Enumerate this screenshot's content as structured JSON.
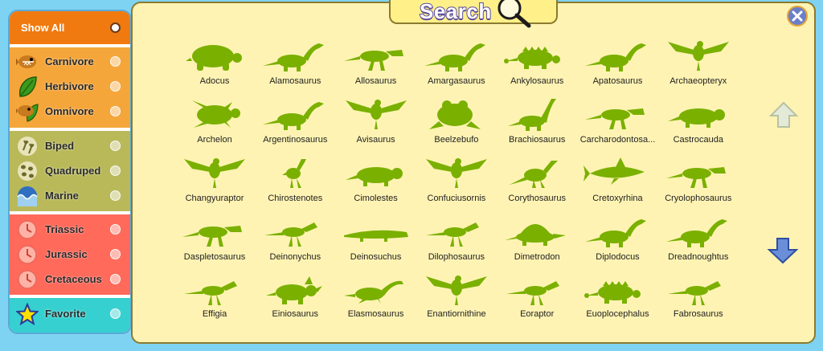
{
  "colors": {
    "background": "#7fd3f2",
    "panel": "#fff3b3",
    "silhouette": "#7ab000",
    "show_all": "#f07a10",
    "diet": "#f5a63a",
    "movement": "#b9b95a",
    "period": "#ff6a5a",
    "favorite": "#36d0d0"
  },
  "sidebar": {
    "show_all": {
      "label": "Show All",
      "selected": true
    },
    "diet": [
      {
        "label": "Carnivore",
        "icon": "carnivore-fish-icon"
      },
      {
        "label": "Herbivore",
        "icon": "leaf-icon"
      },
      {
        "label": "Omnivore",
        "icon": "omnivore-fish-leaf-icon"
      }
    ],
    "movement": [
      {
        "label": "Biped",
        "icon": "biped-footprints-icon"
      },
      {
        "label": "Quadruped",
        "icon": "quadruped-footprints-icon"
      },
      {
        "label": "Marine",
        "icon": "wave-icon"
      }
    ],
    "period": [
      {
        "label": "Triassic",
        "icon": "clock-icon"
      },
      {
        "label": "Jurassic",
        "icon": "clock-icon"
      },
      {
        "label": "Cretaceous",
        "icon": "clock-icon"
      }
    ],
    "favorite": {
      "label": "Favorite",
      "icon": "star-icon"
    }
  },
  "header": {
    "title": "Search",
    "icon": "magnifier-icon"
  },
  "controls": {
    "close_icon": "close-icon",
    "up_icon": "arrow-up-icon",
    "down_icon": "arrow-down-icon"
  },
  "dinosaurs": [
    {
      "name": "Adocus",
      "shape": "turtle"
    },
    {
      "name": "Alamosaurus",
      "shape": "sauropod"
    },
    {
      "name": "Allosaurus",
      "shape": "theropod"
    },
    {
      "name": "Amargasaurus",
      "shape": "sauropod"
    },
    {
      "name": "Ankylosaurus",
      "shape": "ankylosaur"
    },
    {
      "name": "Apatosaurus",
      "shape": "sauropod"
    },
    {
      "name": "Archaeopteryx",
      "shape": "bird"
    },
    {
      "name": "Archelon",
      "shape": "seaturtle"
    },
    {
      "name": "Argentinosaurus",
      "shape": "sauropod"
    },
    {
      "name": "Avisaurus",
      "shape": "bird"
    },
    {
      "name": "Beelzebufo",
      "shape": "frog"
    },
    {
      "name": "Brachiosaurus",
      "shape": "brachio"
    },
    {
      "name": "Carcharodontosa...",
      "shape": "theropod"
    },
    {
      "name": "Castrocauda",
      "shape": "mammal"
    },
    {
      "name": "Changyuraptor",
      "shape": "bird"
    },
    {
      "name": "Chirostenotes",
      "shape": "smallbiped"
    },
    {
      "name": "Cimolestes",
      "shape": "mammal"
    },
    {
      "name": "Confuciusornis",
      "shape": "bird"
    },
    {
      "name": "Corythosaurus",
      "shape": "hadrosaur"
    },
    {
      "name": "Cretoxyrhina",
      "shape": "shark"
    },
    {
      "name": "Cryolophosaurus",
      "shape": "theropod"
    },
    {
      "name": "Daspletosaurus",
      "shape": "theropod"
    },
    {
      "name": "Deinonychus",
      "shape": "raptor"
    },
    {
      "name": "Deinosuchus",
      "shape": "croc"
    },
    {
      "name": "Dilophosaurus",
      "shape": "raptor"
    },
    {
      "name": "Dimetrodon",
      "shape": "sail"
    },
    {
      "name": "Diplodocus",
      "shape": "sauropod"
    },
    {
      "name": "Dreadnoughtus",
      "shape": "sauropod"
    },
    {
      "name": "Effigia",
      "shape": "raptor"
    },
    {
      "name": "Einiosaurus",
      "shape": "ceratopsian"
    },
    {
      "name": "Elasmosaurus",
      "shape": "plesiosaur"
    },
    {
      "name": "Enantiornithine",
      "shape": "bird"
    },
    {
      "name": "Eoraptor",
      "shape": "raptor"
    },
    {
      "name": "Euoplocephalus",
      "shape": "ankylosaur"
    },
    {
      "name": "Fabrosaurus",
      "shape": "raptor"
    }
  ]
}
